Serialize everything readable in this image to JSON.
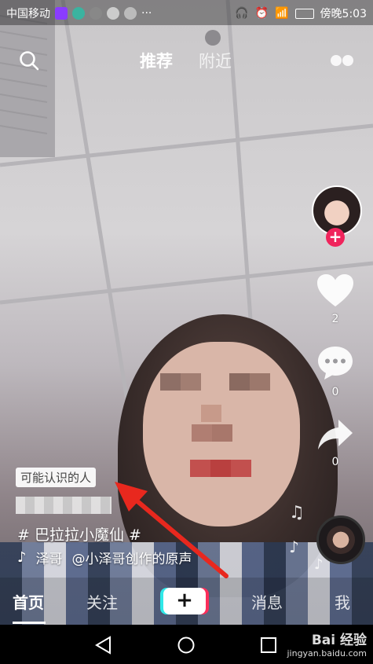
{
  "status_bar": {
    "carrier": "中国移动",
    "time": "傍晚5:03"
  },
  "top_tabs": {
    "recommend": "推荐",
    "nearby": "附近"
  },
  "right_actions": {
    "like_count": "2",
    "comment_count": "0",
    "share_count": "0"
  },
  "video_info": {
    "tag_label": "可能认识的人",
    "hashtag": "# 巴拉拉小魔仙 #",
    "music_author": "泽哥",
    "music_title": "@小泽哥创作的原声"
  },
  "bottom_tabs": {
    "home": "首页",
    "follow": "关注",
    "messages": "消息",
    "me": "我"
  },
  "watermark": {
    "brand": "Bai 经验",
    "url": "jingyan.baidu.com"
  },
  "colors": {
    "follow_red": "#f0245c",
    "annotation_arrow": "#e8281e",
    "plus_cyan": "#2fe8e8",
    "plus_pink": "#fb2e5a"
  }
}
